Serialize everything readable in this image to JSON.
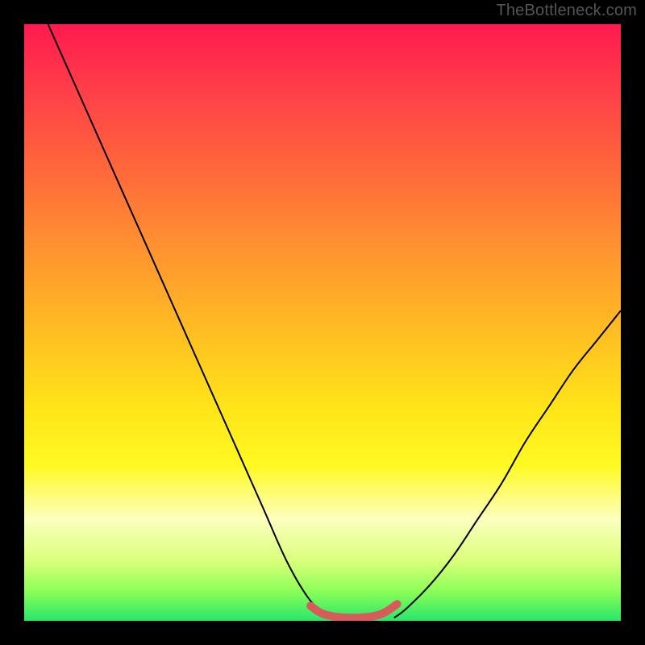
{
  "watermark": "TheBottleneck.com",
  "colors": {
    "gradient_top": "#ff1a4e",
    "gradient_bottom": "#28e66a",
    "curve": "#000000",
    "trough": "#d85a5a",
    "frame": "#000000"
  },
  "chart_data": {
    "type": "line",
    "title": "",
    "xlabel": "",
    "ylabel": "",
    "xlim": [
      0,
      100
    ],
    "ylim": [
      0,
      100
    ],
    "grid": false,
    "legend": false,
    "series": [
      {
        "name": "left-curve",
        "x": [
          4,
          8,
          12,
          16,
          20,
          24,
          28,
          32,
          36,
          40,
          44,
          47.5,
          50,
          52
        ],
        "values": [
          100,
          91,
          82,
          73,
          64,
          55,
          46,
          37,
          28,
          19,
          10,
          4,
          1.5,
          0.5
        ]
      },
      {
        "name": "right-curve",
        "x": [
          62,
          64,
          68,
          72,
          76,
          80,
          84,
          88,
          92,
          96,
          100
        ],
        "values": [
          0.5,
          2,
          6,
          11,
          17,
          23,
          30,
          36,
          42,
          47,
          52
        ]
      },
      {
        "name": "trough-highlight",
        "x": [
          48,
          50,
          53,
          57,
          60,
          62.5
        ],
        "values": [
          2.5,
          1.2,
          0.6,
          0.6,
          1.2,
          2.8
        ]
      }
    ]
  }
}
